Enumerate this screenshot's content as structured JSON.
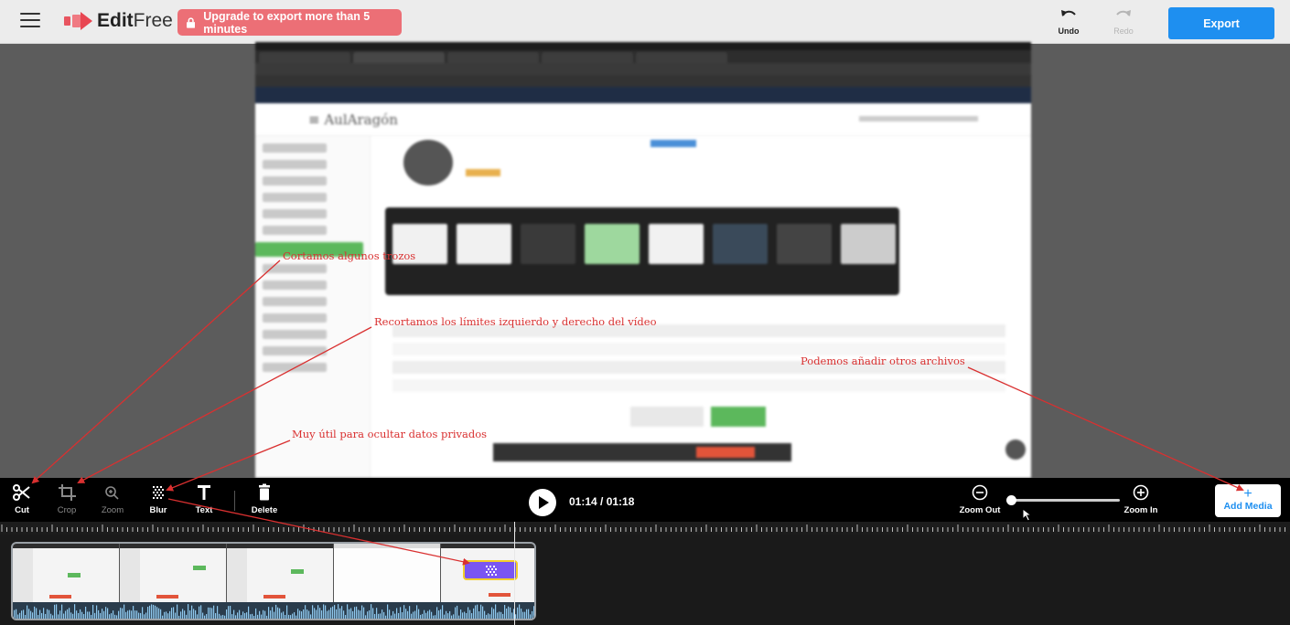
{
  "header": {
    "app_name_bold": "Edit",
    "app_name_light": "Free",
    "upgrade_label": "Upgrade to export more than 5 minutes",
    "undo_label": "Undo",
    "redo_label": "Redo",
    "export_label": "Export"
  },
  "preview": {
    "site_logo": "≡  AulAragón"
  },
  "annotations": {
    "cut_note": "Cortamos algunos trozos",
    "crop_note": "Recortamos los límites izquierdo y derecho del vídeo",
    "blur_note": "Muy útil para ocultar datos privados",
    "media_note": "Podemos añadir otros archivos"
  },
  "toolbar": {
    "tools": [
      {
        "label": "Cut"
      },
      {
        "label": "Crop"
      },
      {
        "label": "Zoom"
      },
      {
        "label": "Blur"
      },
      {
        "label": "Text"
      },
      {
        "label": "Delete"
      }
    ],
    "time_display": "01:14 / 01:18",
    "zoom_out_label": "Zoom Out",
    "zoom_in_label": "Zoom In",
    "zoom_level": 0,
    "add_media_plus": "+",
    "add_media_label": "Add Media"
  },
  "colors": {
    "accent": "#1e8ff0",
    "upgrade": "#ec6f76",
    "annotation": "#d93030",
    "blur_clip": "#7a55f2",
    "blur_clip_border": "#f2cd2b"
  },
  "icons": {
    "menu": "hamburger-icon",
    "logo": "editfree-logo-icon",
    "lock": "lock-icon",
    "undo": "undo-icon",
    "redo": "redo-icon",
    "cut": "scissors-icon",
    "crop": "crop-icon",
    "zoom": "zoom-icon",
    "blur": "blur-grid-icon",
    "text": "text-icon",
    "delete": "trash-icon",
    "play": "play-icon",
    "zoom_out": "minus-circle-icon",
    "zoom_in": "plus-circle-icon"
  }
}
